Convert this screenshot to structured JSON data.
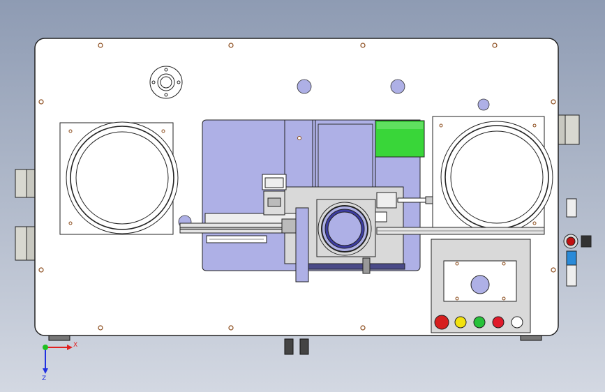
{
  "viewport": {
    "background_top": "#8e9bb3",
    "background_bottom": "#d3d8e2"
  },
  "model": {
    "plate_color": "#ffffff",
    "carrier_color": "#aeb0e6",
    "green_block_color": "#39d639",
    "panel_gray": "#d9d9d9"
  },
  "control_buttons": [
    {
      "name": "emergency-stop-button",
      "color": "#d61f1f"
    },
    {
      "name": "yellow-indicator-button",
      "color": "#f2e20f"
    },
    {
      "name": "green-indicator-button",
      "color": "#27c23a"
    },
    {
      "name": "red-indicator-button",
      "color": "#e01a2a"
    },
    {
      "name": "white-indicator-button",
      "color": "#ffffff"
    }
  ],
  "triad": {
    "x_label": "X",
    "z_label": "Z",
    "x_color": "#e02020",
    "y_color": "#20c020",
    "z_color": "#2030e0"
  }
}
